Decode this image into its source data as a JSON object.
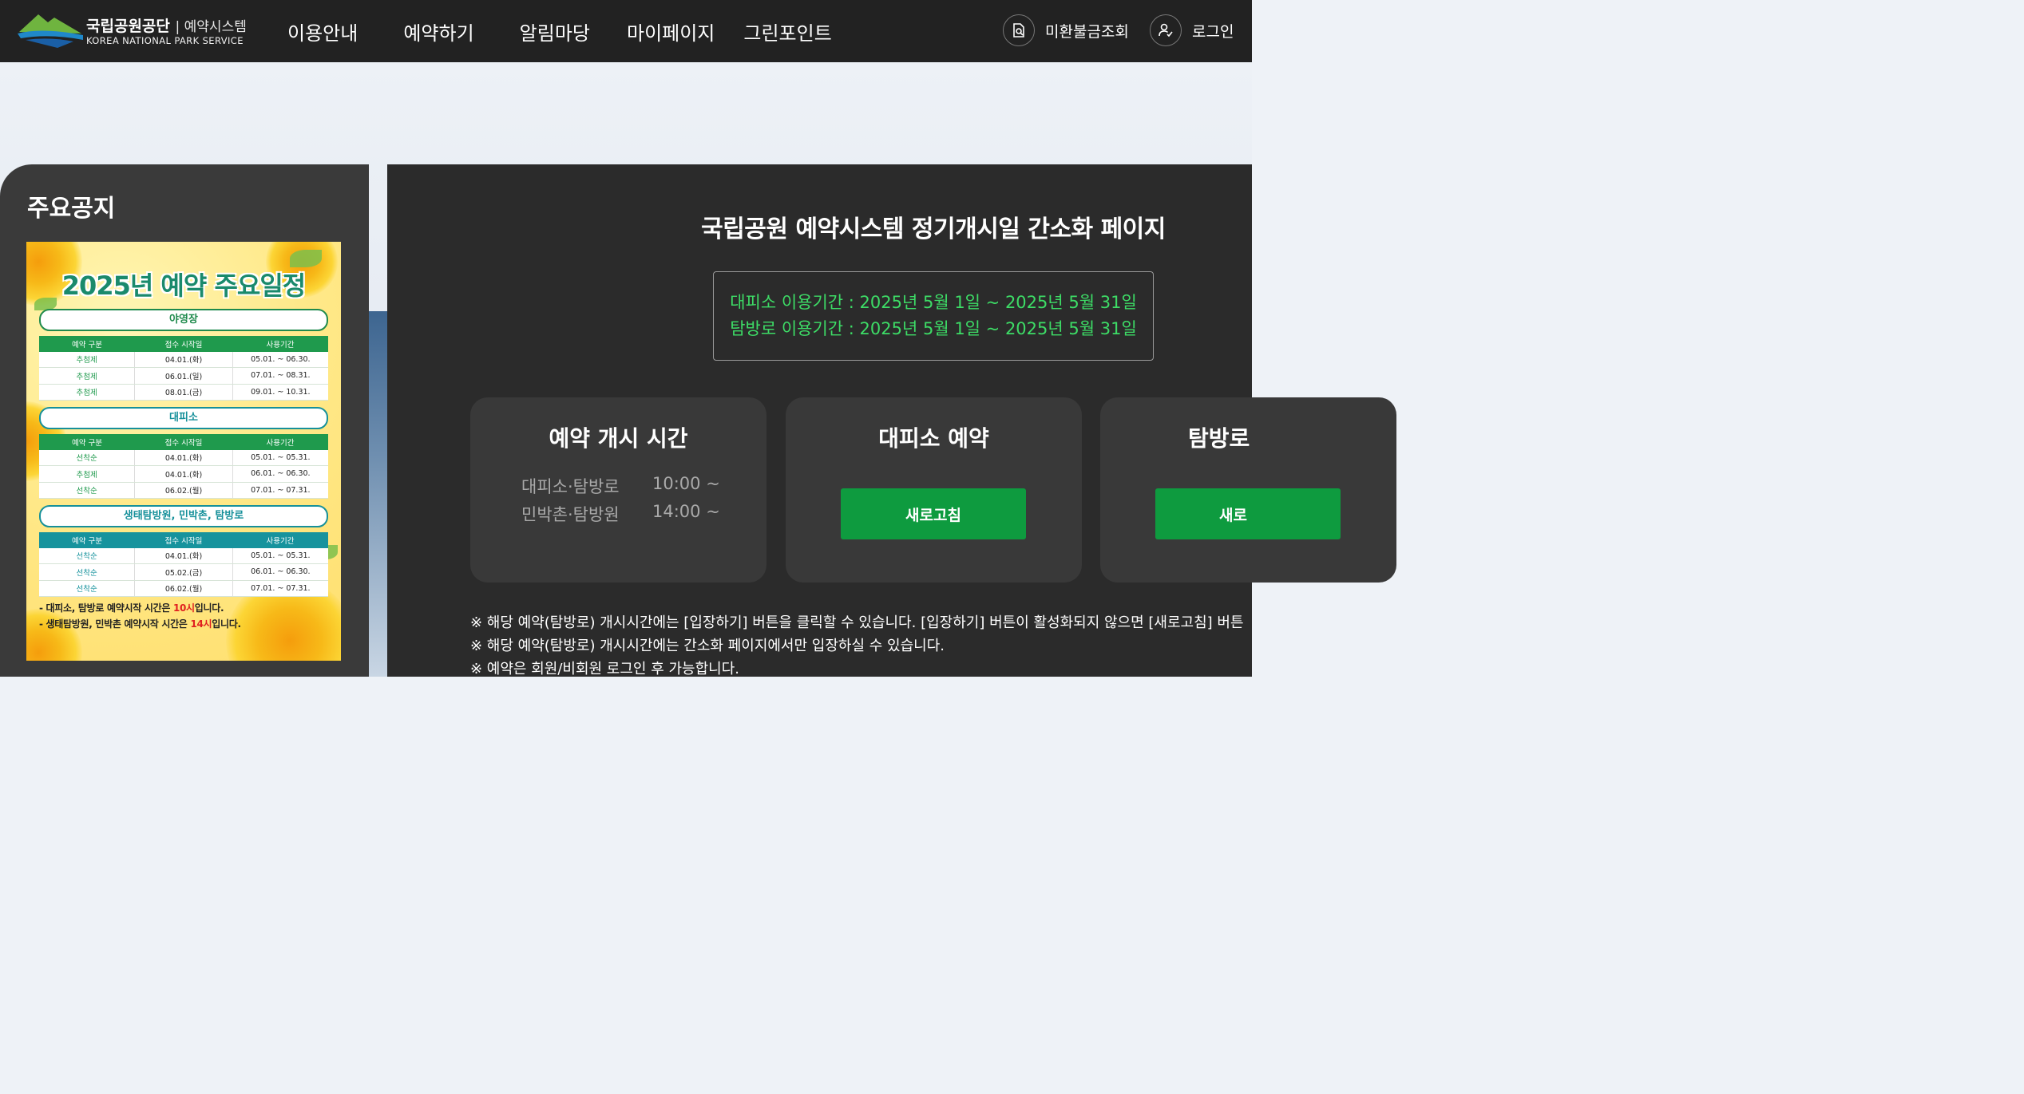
{
  "header": {
    "logo_ko": "국립공원공단",
    "logo_sub": "예약시스템",
    "logo_en": "KOREA NATIONAL PARK SERVICE",
    "nav": [
      "이용안내",
      "예약하기",
      "알림마당",
      "마이페이지",
      "그린포인트"
    ],
    "unpaid_label": "미환불금조회",
    "login_label": "로그인"
  },
  "notice": {
    "title": "주요공지",
    "poster": {
      "title": "2025년 예약 주요일정",
      "sections": [
        {
          "name": "야영장",
          "headers": [
            "예약 구분",
            "접수 시작일",
            "사용기간"
          ],
          "rows": [
            [
              "추첨제",
              "04.01.(화)",
              "05.01. ~ 06.30."
            ],
            [
              "추첨제",
              "06.01.(일)",
              "07.01. ~ 08.31."
            ],
            [
              "추첨제",
              "08.01.(금)",
              "09.01. ~ 10.31."
            ]
          ]
        },
        {
          "name": "대피소",
          "headers": [
            "예약 구분",
            "접수 시작일",
            "사용기간"
          ],
          "rows": [
            [
              "선착순",
              "04.01.(화)",
              "05.01. ~ 05.31."
            ],
            [
              "추첨제",
              "04.01.(화)",
              "06.01. ~ 06.30."
            ],
            [
              "선착순",
              "06.02.(월)",
              "07.01. ~ 07.31."
            ]
          ]
        },
        {
          "name": "생태탐방원, 민박촌, 탐방로",
          "headers": [
            "예약 구분",
            "접수 시작일",
            "사용기간"
          ],
          "rows": [
            [
              "선착순",
              "04.01.(화)",
              "05.01. ~ 05.31."
            ],
            [
              "선착순",
              "05.02.(금)",
              "06.01. ~ 06.30."
            ],
            [
              "선착순",
              "06.02.(월)",
              "07.01. ~ 07.31."
            ]
          ]
        }
      ],
      "note1_a": "- 대피소, 탐방로 예약시작 시간은 ",
      "note1_b": "10시",
      "note1_c": "입니다.",
      "note2_a": "- 생태탐방원, 민박촌 예약시작 시간은 ",
      "note2_b": "14시",
      "note2_c": "입니다."
    }
  },
  "main": {
    "title": "국립공원 예약시스템 정기개시일 간소화 페이지",
    "period_lines": [
      "대피소 이용기간 : 2025년 5월 1일 ~ 2025년 5월 31일",
      "탐방로 이용기간 : 2025년 5월 1일 ~ 2025년 5월 31일"
    ],
    "open_time": {
      "title": "예약 개시 시간",
      "rows": [
        {
          "label": "대피소·탐방로",
          "time": "10:00 ~"
        },
        {
          "label": "민박촌·탐방원",
          "time": "14:00 ~"
        }
      ]
    },
    "shelter": {
      "title": "대피소 예약",
      "button": "새로고침"
    },
    "trail": {
      "title": "탐방로",
      "button": "새로"
    },
    "notes": [
      "※ 해당 예약(탐방로) 개시시간에는 [입장하기] 버튼을 클릭할 수 있습니다. [입장하기] 버튼이 활성화되지 않으면 [새로고침] 버튼",
      "※ 해당 예약(탐방로) 개시시간에는 간소화 페이지에서만 입장하실 수 있습니다.",
      "※ 예약은 회원/비회원 로그인 후 가능합니다."
    ]
  },
  "colors": {
    "header_bg": "#222222",
    "panel_bg": "#2b2b2b",
    "accent_green": "#0e9b3f",
    "period_text": "#3ddc66"
  }
}
